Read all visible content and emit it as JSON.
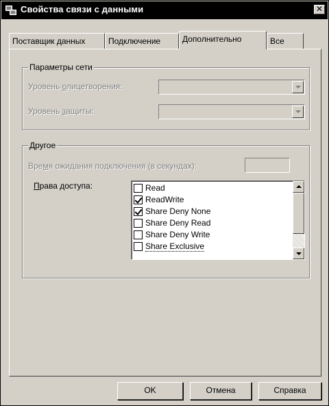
{
  "window": {
    "title": "Свойства связи с данными",
    "close_glyph": "✕"
  },
  "tabs": [
    {
      "label": "Поставщик данных",
      "active": false
    },
    {
      "label": "Подключение",
      "active": false
    },
    {
      "label": "Дополнительно",
      "active": true
    },
    {
      "label": "Все",
      "active": false
    }
  ],
  "network": {
    "legend": "Параметры сети",
    "impersonation_prefix": "Уровень ",
    "impersonation_accel": "о",
    "impersonation_suffix": "лицетворения:",
    "impersonation_value": "",
    "protection_prefix": "Уровень ",
    "protection_accel": "з",
    "protection_suffix": "ащиты:",
    "protection_value": ""
  },
  "other": {
    "legend": "Другое",
    "timeout_prefix": "Вре",
    "timeout_accel": "м",
    "timeout_suffix": "я ожидания подключения (в секундах):",
    "timeout_value": "",
    "access_accel": "П",
    "access_suffix": "рава доступа:",
    "access_items": [
      {
        "label": "Read",
        "checked": false
      },
      {
        "label": "ReadWrite",
        "checked": true
      },
      {
        "label": "Share Deny None",
        "checked": true
      },
      {
        "label": "Share Deny Read",
        "checked": false
      },
      {
        "label": "Share Deny Write",
        "checked": false
      },
      {
        "label": "Share Exclusive",
        "checked": false
      }
    ]
  },
  "buttons": {
    "ok": "OK",
    "cancel": "Отмена",
    "help": "Справка"
  },
  "colors": {
    "face": "#d4d0c8",
    "titlebar": "#000000",
    "disabled_text": "#808080"
  }
}
